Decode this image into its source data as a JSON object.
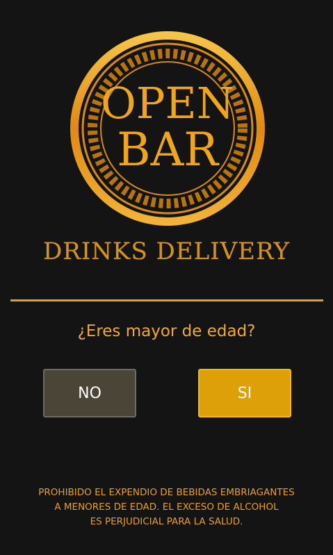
{
  "logo": {
    "line1": "OPEN",
    "line2": "BAR",
    "icon": "open-bar-logo-icon"
  },
  "tagline": "DRINKS DELIVERY",
  "question": "¿Eres mayor de edad?",
  "buttons": {
    "no_label": "NO",
    "si_label": "SI"
  },
  "warning": {
    "line1": "PROHIBIDO EL EXPENDIO DE BEBIDAS EMBRIAGANTES",
    "line2": "A MENORES DE EDAD. EL EXCESO DE ALCOHOL",
    "line3": "ES PERJUDICIAL PARA LA SALUD."
  },
  "colors": {
    "background": "#141414",
    "gold": "#e0a12e",
    "button_no": "#4a4536",
    "button_si": "#dea008"
  }
}
